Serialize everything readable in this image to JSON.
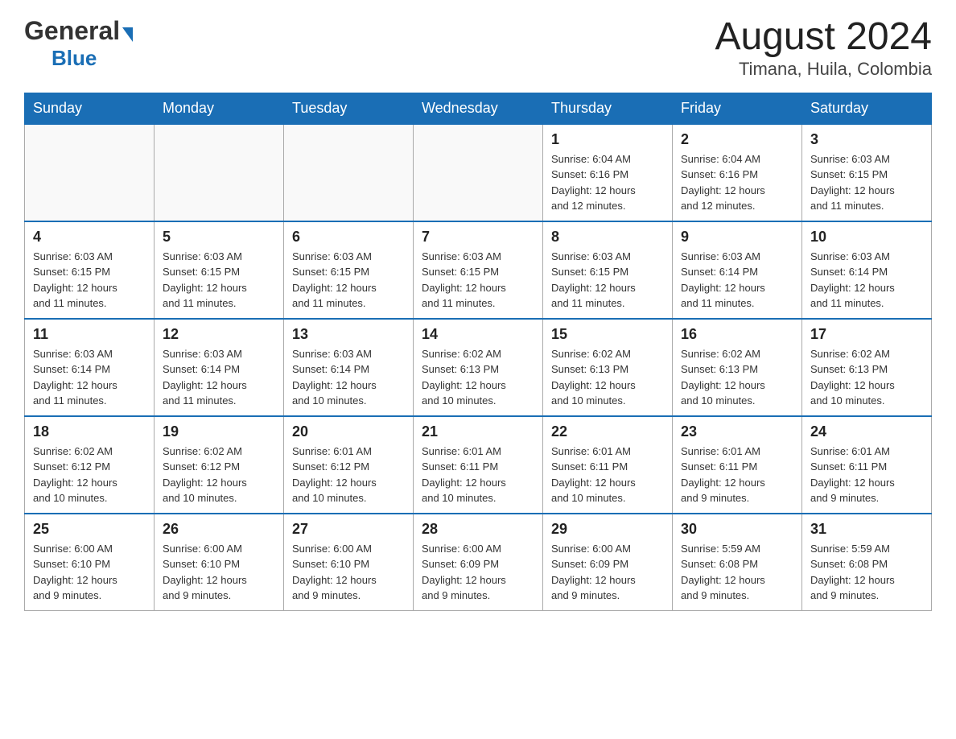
{
  "header": {
    "logo_general": "General",
    "logo_blue": "Blue",
    "title": "August 2024",
    "subtitle": "Timana, Huila, Colombia"
  },
  "weekdays": [
    "Sunday",
    "Monday",
    "Tuesday",
    "Wednesday",
    "Thursday",
    "Friday",
    "Saturday"
  ],
  "weeks": [
    {
      "days": [
        {
          "num": "",
          "info": ""
        },
        {
          "num": "",
          "info": ""
        },
        {
          "num": "",
          "info": ""
        },
        {
          "num": "",
          "info": ""
        },
        {
          "num": "1",
          "info": "Sunrise: 6:04 AM\nSunset: 6:16 PM\nDaylight: 12 hours\nand 12 minutes."
        },
        {
          "num": "2",
          "info": "Sunrise: 6:04 AM\nSunset: 6:16 PM\nDaylight: 12 hours\nand 12 minutes."
        },
        {
          "num": "3",
          "info": "Sunrise: 6:03 AM\nSunset: 6:15 PM\nDaylight: 12 hours\nand 11 minutes."
        }
      ]
    },
    {
      "days": [
        {
          "num": "4",
          "info": "Sunrise: 6:03 AM\nSunset: 6:15 PM\nDaylight: 12 hours\nand 11 minutes."
        },
        {
          "num": "5",
          "info": "Sunrise: 6:03 AM\nSunset: 6:15 PM\nDaylight: 12 hours\nand 11 minutes."
        },
        {
          "num": "6",
          "info": "Sunrise: 6:03 AM\nSunset: 6:15 PM\nDaylight: 12 hours\nand 11 minutes."
        },
        {
          "num": "7",
          "info": "Sunrise: 6:03 AM\nSunset: 6:15 PM\nDaylight: 12 hours\nand 11 minutes."
        },
        {
          "num": "8",
          "info": "Sunrise: 6:03 AM\nSunset: 6:15 PM\nDaylight: 12 hours\nand 11 minutes."
        },
        {
          "num": "9",
          "info": "Sunrise: 6:03 AM\nSunset: 6:14 PM\nDaylight: 12 hours\nand 11 minutes."
        },
        {
          "num": "10",
          "info": "Sunrise: 6:03 AM\nSunset: 6:14 PM\nDaylight: 12 hours\nand 11 minutes."
        }
      ]
    },
    {
      "days": [
        {
          "num": "11",
          "info": "Sunrise: 6:03 AM\nSunset: 6:14 PM\nDaylight: 12 hours\nand 11 minutes."
        },
        {
          "num": "12",
          "info": "Sunrise: 6:03 AM\nSunset: 6:14 PM\nDaylight: 12 hours\nand 11 minutes."
        },
        {
          "num": "13",
          "info": "Sunrise: 6:03 AM\nSunset: 6:14 PM\nDaylight: 12 hours\nand 10 minutes."
        },
        {
          "num": "14",
          "info": "Sunrise: 6:02 AM\nSunset: 6:13 PM\nDaylight: 12 hours\nand 10 minutes."
        },
        {
          "num": "15",
          "info": "Sunrise: 6:02 AM\nSunset: 6:13 PM\nDaylight: 12 hours\nand 10 minutes."
        },
        {
          "num": "16",
          "info": "Sunrise: 6:02 AM\nSunset: 6:13 PM\nDaylight: 12 hours\nand 10 minutes."
        },
        {
          "num": "17",
          "info": "Sunrise: 6:02 AM\nSunset: 6:13 PM\nDaylight: 12 hours\nand 10 minutes."
        }
      ]
    },
    {
      "days": [
        {
          "num": "18",
          "info": "Sunrise: 6:02 AM\nSunset: 6:12 PM\nDaylight: 12 hours\nand 10 minutes."
        },
        {
          "num": "19",
          "info": "Sunrise: 6:02 AM\nSunset: 6:12 PM\nDaylight: 12 hours\nand 10 minutes."
        },
        {
          "num": "20",
          "info": "Sunrise: 6:01 AM\nSunset: 6:12 PM\nDaylight: 12 hours\nand 10 minutes."
        },
        {
          "num": "21",
          "info": "Sunrise: 6:01 AM\nSunset: 6:11 PM\nDaylight: 12 hours\nand 10 minutes."
        },
        {
          "num": "22",
          "info": "Sunrise: 6:01 AM\nSunset: 6:11 PM\nDaylight: 12 hours\nand 10 minutes."
        },
        {
          "num": "23",
          "info": "Sunrise: 6:01 AM\nSunset: 6:11 PM\nDaylight: 12 hours\nand 9 minutes."
        },
        {
          "num": "24",
          "info": "Sunrise: 6:01 AM\nSunset: 6:11 PM\nDaylight: 12 hours\nand 9 minutes."
        }
      ]
    },
    {
      "days": [
        {
          "num": "25",
          "info": "Sunrise: 6:00 AM\nSunset: 6:10 PM\nDaylight: 12 hours\nand 9 minutes."
        },
        {
          "num": "26",
          "info": "Sunrise: 6:00 AM\nSunset: 6:10 PM\nDaylight: 12 hours\nand 9 minutes."
        },
        {
          "num": "27",
          "info": "Sunrise: 6:00 AM\nSunset: 6:10 PM\nDaylight: 12 hours\nand 9 minutes."
        },
        {
          "num": "28",
          "info": "Sunrise: 6:00 AM\nSunset: 6:09 PM\nDaylight: 12 hours\nand 9 minutes."
        },
        {
          "num": "29",
          "info": "Sunrise: 6:00 AM\nSunset: 6:09 PM\nDaylight: 12 hours\nand 9 minutes."
        },
        {
          "num": "30",
          "info": "Sunrise: 5:59 AM\nSunset: 6:08 PM\nDaylight: 12 hours\nand 9 minutes."
        },
        {
          "num": "31",
          "info": "Sunrise: 5:59 AM\nSunset: 6:08 PM\nDaylight: 12 hours\nand 9 minutes."
        }
      ]
    }
  ]
}
